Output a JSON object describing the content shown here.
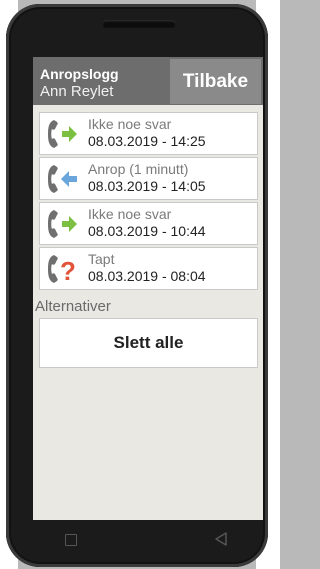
{
  "header": {
    "title": "Anropslogg",
    "subtitle": "Ann Reylet",
    "back_label": "Tilbake"
  },
  "calls": [
    {
      "status": "Ikke noe svar",
      "datetime": "08.03.2019 - 14:25",
      "icon": "outgoing-call-icon",
      "color": "#7bc043"
    },
    {
      "status": "Anrop (1 minutt)",
      "datetime": "08.03.2019 - 14:05",
      "icon": "incoming-call-icon",
      "color": "#6aa6dc"
    },
    {
      "status": "Ikke noe svar",
      "datetime": "08.03.2019 - 10:44",
      "icon": "outgoing-call-icon",
      "color": "#7bc043"
    },
    {
      "status": "Tapt",
      "datetime": "08.03.2019 - 08:04",
      "icon": "missed-call-icon",
      "color": "#e2543a"
    }
  ],
  "alternatives": {
    "label": "Alternativer",
    "delete_all_label": "Slett alle"
  },
  "navbar": {
    "icons": [
      "recent-apps-icon",
      "back-icon"
    ]
  }
}
